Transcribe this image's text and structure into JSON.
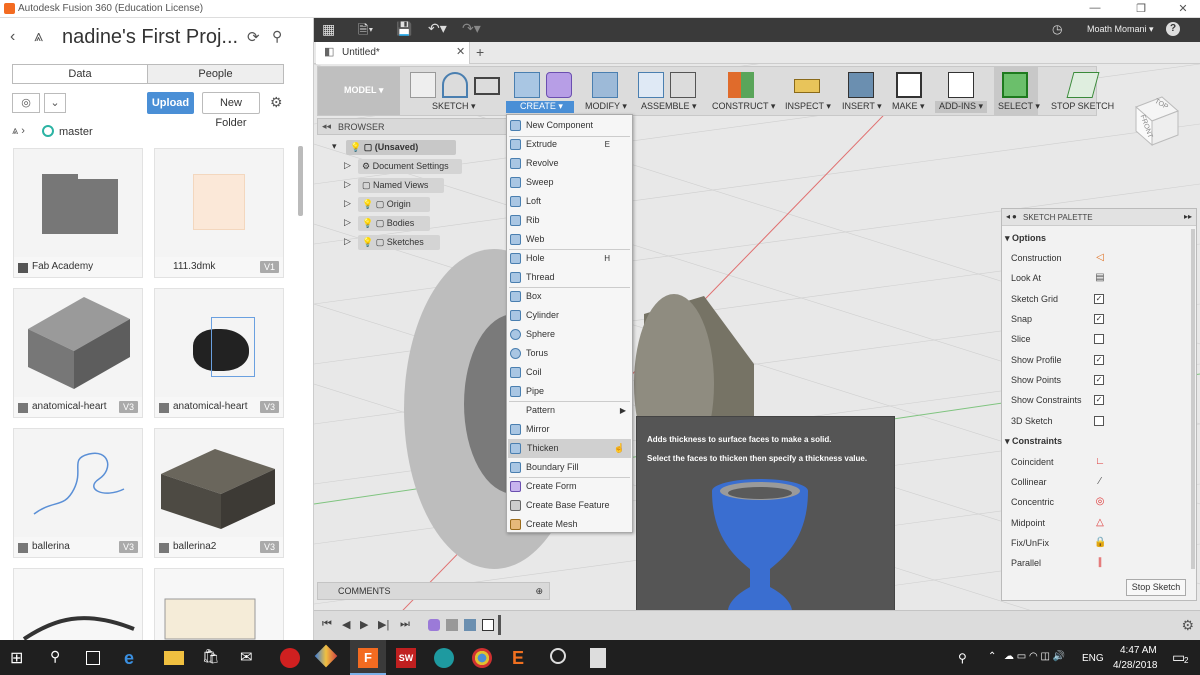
{
  "window": {
    "title": "Autodesk Fusion 360 (Education License)"
  },
  "left_panel": {
    "project_title": "nadine's First Proj...",
    "tabs": [
      "Data",
      "People"
    ],
    "upload_label": "Upload",
    "new_folder_label": "New Folder",
    "breadcrumb": "master",
    "cards": [
      {
        "name": "Fab Academy",
        "version": ""
      },
      {
        "name": "111.3dmk",
        "version": "V1"
      },
      {
        "name": "anatomical-heart",
        "version": "V3"
      },
      {
        "name": "anatomical-heart",
        "version": "V3"
      },
      {
        "name": "ballerina",
        "version": "V3"
      },
      {
        "name": "ballerina2",
        "version": "V3"
      }
    ]
  },
  "top_bar": {
    "user": "Moath Momani ▾",
    "help": "?"
  },
  "doc_tab": {
    "title": "Untitled*"
  },
  "ribbon": {
    "workspace": "MODEL ▾",
    "groups": [
      "SKETCH ▾",
      "CREATE ▾",
      "MODIFY ▾",
      "ASSEMBLE ▾",
      "CONSTRUCT ▾",
      "INSPECT ▾",
      "INSERT ▾",
      "MAKE ▾",
      "ADD-INS ▾",
      "SELECT ▾",
      "STOP SKETCH"
    ]
  },
  "browser": {
    "header": "BROWSER",
    "items": [
      "(Unsaved)",
      "Document Settings",
      "Named Views",
      "Origin",
      "Bodies",
      "Sketches"
    ]
  },
  "create_menu": {
    "items": [
      {
        "label": "New Component",
        "shortcut": ""
      },
      {
        "label": "Extrude",
        "shortcut": "E"
      },
      {
        "label": "Revolve",
        "shortcut": ""
      },
      {
        "label": "Sweep",
        "shortcut": ""
      },
      {
        "label": "Loft",
        "shortcut": ""
      },
      {
        "label": "Rib",
        "shortcut": ""
      },
      {
        "label": "Web",
        "shortcut": ""
      },
      {
        "label": "Hole",
        "shortcut": "H"
      },
      {
        "label": "Thread",
        "shortcut": ""
      },
      {
        "label": "Box",
        "shortcut": ""
      },
      {
        "label": "Cylinder",
        "shortcut": ""
      },
      {
        "label": "Sphere",
        "shortcut": ""
      },
      {
        "label": "Torus",
        "shortcut": ""
      },
      {
        "label": "Coil",
        "shortcut": ""
      },
      {
        "label": "Pipe",
        "shortcut": ""
      },
      {
        "label": "Pattern",
        "shortcut": ""
      },
      {
        "label": "Mirror",
        "shortcut": ""
      },
      {
        "label": "Thicken",
        "shortcut": ""
      },
      {
        "label": "Boundary Fill",
        "shortcut": ""
      },
      {
        "label": "Create Form",
        "shortcut": ""
      },
      {
        "label": "Create Base Feature",
        "shortcut": ""
      },
      {
        "label": "Create Mesh",
        "shortcut": ""
      }
    ]
  },
  "tooltip": {
    "line1": "Adds thickness to surface faces to make a solid.",
    "line2": "Select the faces to thicken then specify a thickness value."
  },
  "sketch_palette": {
    "title": "SKETCH PALETTE",
    "options_header": "Options",
    "options": [
      {
        "label": "Construction",
        "checked": null
      },
      {
        "label": "Look At",
        "checked": null
      },
      {
        "label": "Sketch Grid",
        "checked": true
      },
      {
        "label": "Snap",
        "checked": true
      },
      {
        "label": "Slice",
        "checked": false
      },
      {
        "label": "Show Profile",
        "checked": true
      },
      {
        "label": "Show Points",
        "checked": true
      },
      {
        "label": "Show Constraints",
        "checked": true
      },
      {
        "label": "3D Sketch",
        "checked": false
      }
    ],
    "constraints_header": "Constraints",
    "constraints": [
      "Coincident",
      "Collinear",
      "Concentric",
      "Midpoint",
      "Fix/UnFix",
      "Parallel"
    ],
    "stop_label": "Stop Sketch"
  },
  "comments": {
    "label": "COMMENTS"
  },
  "viewcube": {
    "top": "TOP",
    "front": "FRONT"
  },
  "taskbar": {
    "lang": "ENG",
    "time": "4:47 AM",
    "date": "4/28/2018",
    "badge": "2"
  }
}
